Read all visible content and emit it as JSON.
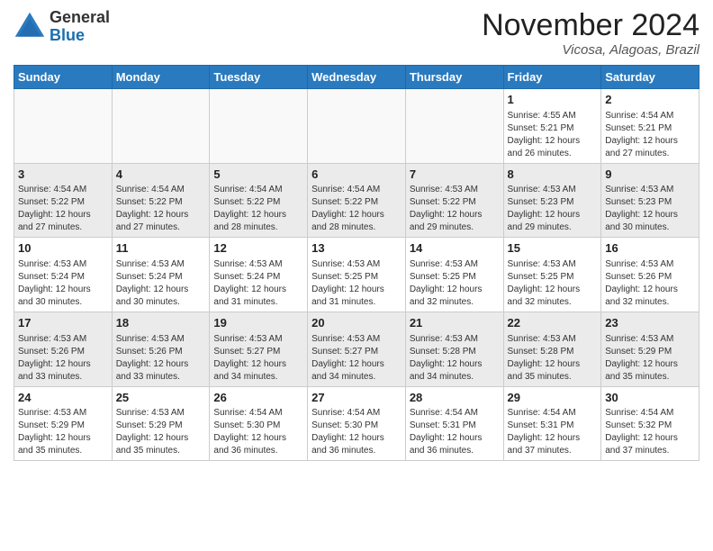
{
  "header": {
    "logo_general": "General",
    "logo_blue": "Blue",
    "month_title": "November 2024",
    "location": "Vicosa, Alagoas, Brazil"
  },
  "weekdays": [
    "Sunday",
    "Monday",
    "Tuesday",
    "Wednesday",
    "Thursday",
    "Friday",
    "Saturday"
  ],
  "weeks": [
    [
      {
        "day": "",
        "info": "",
        "empty": true
      },
      {
        "day": "",
        "info": "",
        "empty": true
      },
      {
        "day": "",
        "info": "",
        "empty": true
      },
      {
        "day": "",
        "info": "",
        "empty": true
      },
      {
        "day": "",
        "info": "",
        "empty": true
      },
      {
        "day": "1",
        "info": "Sunrise: 4:55 AM\nSunset: 5:21 PM\nDaylight: 12 hours\nand 26 minutes.",
        "empty": false
      },
      {
        "day": "2",
        "info": "Sunrise: 4:54 AM\nSunset: 5:21 PM\nDaylight: 12 hours\nand 27 minutes.",
        "empty": false
      }
    ],
    [
      {
        "day": "3",
        "info": "Sunrise: 4:54 AM\nSunset: 5:22 PM\nDaylight: 12 hours\nand 27 minutes.",
        "empty": false
      },
      {
        "day": "4",
        "info": "Sunrise: 4:54 AM\nSunset: 5:22 PM\nDaylight: 12 hours\nand 27 minutes.",
        "empty": false
      },
      {
        "day": "5",
        "info": "Sunrise: 4:54 AM\nSunset: 5:22 PM\nDaylight: 12 hours\nand 28 minutes.",
        "empty": false
      },
      {
        "day": "6",
        "info": "Sunrise: 4:54 AM\nSunset: 5:22 PM\nDaylight: 12 hours\nand 28 minutes.",
        "empty": false
      },
      {
        "day": "7",
        "info": "Sunrise: 4:53 AM\nSunset: 5:22 PM\nDaylight: 12 hours\nand 29 minutes.",
        "empty": false
      },
      {
        "day": "8",
        "info": "Sunrise: 4:53 AM\nSunset: 5:23 PM\nDaylight: 12 hours\nand 29 minutes.",
        "empty": false
      },
      {
        "day": "9",
        "info": "Sunrise: 4:53 AM\nSunset: 5:23 PM\nDaylight: 12 hours\nand 30 minutes.",
        "empty": false
      }
    ],
    [
      {
        "day": "10",
        "info": "Sunrise: 4:53 AM\nSunset: 5:24 PM\nDaylight: 12 hours\nand 30 minutes.",
        "empty": false
      },
      {
        "day": "11",
        "info": "Sunrise: 4:53 AM\nSunset: 5:24 PM\nDaylight: 12 hours\nand 30 minutes.",
        "empty": false
      },
      {
        "day": "12",
        "info": "Sunrise: 4:53 AM\nSunset: 5:24 PM\nDaylight: 12 hours\nand 31 minutes.",
        "empty": false
      },
      {
        "day": "13",
        "info": "Sunrise: 4:53 AM\nSunset: 5:25 PM\nDaylight: 12 hours\nand 31 minutes.",
        "empty": false
      },
      {
        "day": "14",
        "info": "Sunrise: 4:53 AM\nSunset: 5:25 PM\nDaylight: 12 hours\nand 32 minutes.",
        "empty": false
      },
      {
        "day": "15",
        "info": "Sunrise: 4:53 AM\nSunset: 5:25 PM\nDaylight: 12 hours\nand 32 minutes.",
        "empty": false
      },
      {
        "day": "16",
        "info": "Sunrise: 4:53 AM\nSunset: 5:26 PM\nDaylight: 12 hours\nand 32 minutes.",
        "empty": false
      }
    ],
    [
      {
        "day": "17",
        "info": "Sunrise: 4:53 AM\nSunset: 5:26 PM\nDaylight: 12 hours\nand 33 minutes.",
        "empty": false
      },
      {
        "day": "18",
        "info": "Sunrise: 4:53 AM\nSunset: 5:26 PM\nDaylight: 12 hours\nand 33 minutes.",
        "empty": false
      },
      {
        "day": "19",
        "info": "Sunrise: 4:53 AM\nSunset: 5:27 PM\nDaylight: 12 hours\nand 34 minutes.",
        "empty": false
      },
      {
        "day": "20",
        "info": "Sunrise: 4:53 AM\nSunset: 5:27 PM\nDaylight: 12 hours\nand 34 minutes.",
        "empty": false
      },
      {
        "day": "21",
        "info": "Sunrise: 4:53 AM\nSunset: 5:28 PM\nDaylight: 12 hours\nand 34 minutes.",
        "empty": false
      },
      {
        "day": "22",
        "info": "Sunrise: 4:53 AM\nSunset: 5:28 PM\nDaylight: 12 hours\nand 35 minutes.",
        "empty": false
      },
      {
        "day": "23",
        "info": "Sunrise: 4:53 AM\nSunset: 5:29 PM\nDaylight: 12 hours\nand 35 minutes.",
        "empty": false
      }
    ],
    [
      {
        "day": "24",
        "info": "Sunrise: 4:53 AM\nSunset: 5:29 PM\nDaylight: 12 hours\nand 35 minutes.",
        "empty": false
      },
      {
        "day": "25",
        "info": "Sunrise: 4:53 AM\nSunset: 5:29 PM\nDaylight: 12 hours\nand 35 minutes.",
        "empty": false
      },
      {
        "day": "26",
        "info": "Sunrise: 4:54 AM\nSunset: 5:30 PM\nDaylight: 12 hours\nand 36 minutes.",
        "empty": false
      },
      {
        "day": "27",
        "info": "Sunrise: 4:54 AM\nSunset: 5:30 PM\nDaylight: 12 hours\nand 36 minutes.",
        "empty": false
      },
      {
        "day": "28",
        "info": "Sunrise: 4:54 AM\nSunset: 5:31 PM\nDaylight: 12 hours\nand 36 minutes.",
        "empty": false
      },
      {
        "day": "29",
        "info": "Sunrise: 4:54 AM\nSunset: 5:31 PM\nDaylight: 12 hours\nand 37 minutes.",
        "empty": false
      },
      {
        "day": "30",
        "info": "Sunrise: 4:54 AM\nSunset: 5:32 PM\nDaylight: 12 hours\nand 37 minutes.",
        "empty": false
      }
    ]
  ]
}
